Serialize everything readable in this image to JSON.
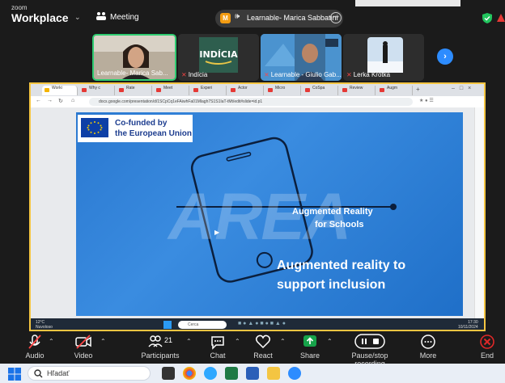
{
  "zoom": {
    "brand_small": "zoom",
    "brand_big": "Workplace",
    "meeting_label": "Meeting",
    "active_speaker_initial": "M",
    "active_speaker_name": "Learnable- Marica Sabbatini",
    "participants": [
      {
        "label": "Learnable- Marica Sab..."
      },
      {
        "label": "Indícia",
        "logo_text": "INDÍCIA"
      },
      {
        "label": "Learnable - Giulio Gab..."
      },
      {
        "label": "Lerka Krotka"
      }
    ]
  },
  "browser": {
    "tabs": [
      "Worki",
      "Why c",
      "Rate",
      "Meet",
      "Experi",
      "Actor",
      "Micro",
      "CoSpa",
      "Review",
      "Augm"
    ],
    "url": "docs.google.com/presentation/d/1SCpCq1eFAiwhFa01Mlagh7S1S1IaT-tMt/edit#slide=id.p1"
  },
  "slide": {
    "eu_line1": "Co-funded by",
    "eu_line2": "the European Union",
    "logo_text": "AREA",
    "tagline1": "Augmented Reality",
    "tagline2": "for Schools",
    "headline1": "Augmented reality to",
    "headline2": "support inclusion"
  },
  "inner_taskbar": {
    "weather_temp": "12°C",
    "weather_desc": "Nuvoloso",
    "search": "Cerca",
    "time": "17:30",
    "date": "10/11/2024"
  },
  "toolbar": {
    "audio": "Audio",
    "video": "Video",
    "participants": "Participants",
    "participants_count": "21",
    "chat": "Chat",
    "react": "React",
    "share": "Share",
    "record": "Pause/stop recording",
    "more": "More",
    "end": "End"
  },
  "windows": {
    "search_placeholder": "Hľadať"
  },
  "colors": {
    "zoom_bg": "#1b1b1b",
    "share_border": "#f4c542",
    "slide_blue": "#2a78d0",
    "share_green": "#16a34a",
    "end_red": "#e02828"
  }
}
